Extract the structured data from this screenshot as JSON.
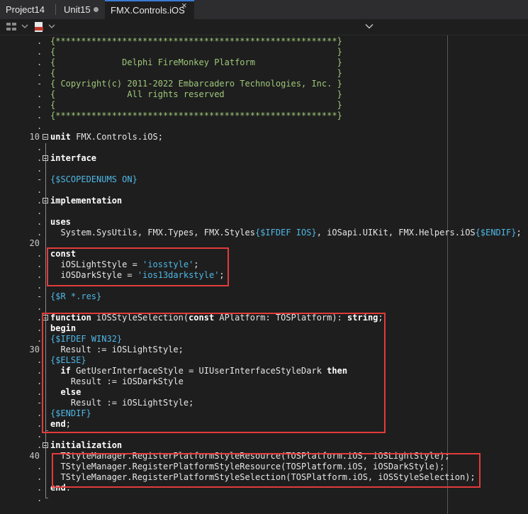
{
  "tabs": [
    {
      "label": "Project14"
    },
    {
      "label": "Unit15"
    },
    {
      "label": "FMX.Controls.iOS"
    }
  ],
  "tab_close_icon": "×",
  "toolbar_icons": [
    "structure-icon",
    "dropdown-chevron-icon",
    "file-uses-icon",
    "method-dropdown-chevron-icon"
  ],
  "code_lines": [
    {
      "g": ".",
      "text": "{*******************************************************}"
    },
    {
      "g": ".",
      "text": "{                                                       }"
    },
    {
      "g": ".",
      "text": "{             Delphi FireMonkey Platform                }"
    },
    {
      "g": ".",
      "text": "{                                                       }"
    },
    {
      "g": "-",
      "text": "{ Copyright(c) 2011-2022 Embarcadero Technologies, Inc. }"
    },
    {
      "g": ".",
      "text": "{              All rights reserved                      }"
    },
    {
      "g": ".",
      "text": "{                                                       }"
    },
    {
      "g": ".",
      "text": "{*******************************************************}"
    },
    {
      "g": ".",
      "text": ""
    },
    {
      "g": "10",
      "text": "unit FMX.Controls.iOS;"
    },
    {
      "g": ".",
      "text": ""
    },
    {
      "g": ".",
      "text": "interface"
    },
    {
      "g": ".",
      "text": ""
    },
    {
      "g": "-",
      "text": "{$SCOPEDENUMS ON}"
    },
    {
      "g": ".",
      "text": ""
    },
    {
      "g": ".",
      "text": "implementation"
    },
    {
      "g": ".",
      "text": ""
    },
    {
      "g": ".",
      "text": "uses"
    },
    {
      "g": ".",
      "text": "  System.SysUtils, FMX.Types, FMX.Styles{$IFDEF IOS}, iOSapi.UIKit, FMX.Helpers.iOS{$ENDIF};"
    },
    {
      "g": "20",
      "text": ""
    },
    {
      "g": ".",
      "text": "const"
    },
    {
      "g": ".",
      "text": "  iOSLightStyle = 'iosstyle';"
    },
    {
      "g": ".",
      "text": "  iOSDarkStyle = 'ios13darkstyle';"
    },
    {
      "g": ".",
      "text": ""
    },
    {
      "g": "-",
      "text": "{$R *.res}"
    },
    {
      "g": ".",
      "text": ""
    },
    {
      "g": ".",
      "text": "function iOSStyleSelection(const APlatform: TOSPlatform): string;"
    },
    {
      "g": ".",
      "text": "begin"
    },
    {
      "g": ".",
      "text": "{$IFDEF WIN32}"
    },
    {
      "g": "30",
      "text": "  Result := iOSLightStyle;"
    },
    {
      "g": ".",
      "text": "{$ELSE}"
    },
    {
      "g": ".",
      "text": "  if GetUserInterfaceStyle = UIUserInterfaceStyleDark then"
    },
    {
      "g": ".",
      "text": "    Result := iOSDarkStyle"
    },
    {
      "g": ".",
      "text": "  else"
    },
    {
      "g": "-",
      "text": "    Result := iOSLightStyle;"
    },
    {
      "g": ".",
      "text": "{$ENDIF}"
    },
    {
      "g": ".",
      "text": "end;"
    },
    {
      "g": ".",
      "text": ""
    },
    {
      "g": ".",
      "text": "initialization"
    },
    {
      "g": "40",
      "text": "  TStyleManager.RegisterPlatformStyleResource(TOSPlatform.iOS, iOSLightStyle);"
    },
    {
      "g": ".",
      "text": "  TStyleManager.RegisterPlatformStyleResource(TOSPlatform.iOS, iOSDarkStyle);"
    },
    {
      "g": ".",
      "text": "  TStyleManager.RegisterPlatformStyleSelection(TOSPlatform.iOS, iOSStyleSelection);"
    },
    {
      "g": ".",
      "text": "end."
    },
    {
      "g": ".",
      "text": ""
    }
  ],
  "colors": {
    "background": "#1e1e1e",
    "comment": "#9fc77a",
    "directive": "#4fb7e6",
    "keyword": "#ffffff",
    "string": "#4fb7e6",
    "highlight_box": "#e23b3b"
  }
}
